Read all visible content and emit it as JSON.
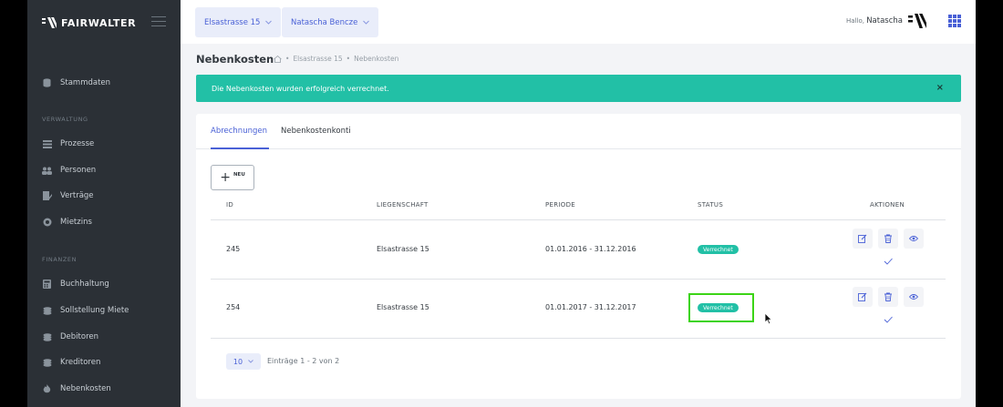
{
  "brand": {
    "name": "FAIRWALTER"
  },
  "sidebar": {
    "stammdaten": "Stammdaten",
    "section_verwaltung": "VERWALTUNG",
    "verwaltung_items": [
      "Prozesse",
      "Personen",
      "Verträge",
      "Mietzins"
    ],
    "section_finanzen": "FINANZEN",
    "finanzen_items": [
      "Buchhaltung",
      "Sollstellung Miete",
      "Debitoren",
      "Kreditoren",
      "Nebenkosten"
    ]
  },
  "topbar": {
    "property_select": "Elsastrasse 15",
    "person_select": "Natascha Bencze",
    "greeting": "Hallo,",
    "user_name": "Natascha"
  },
  "page": {
    "title": "Nebenkosten",
    "breadcrumb": [
      "Elsastrasse 15",
      "Nebenkosten"
    ],
    "breadcrumb_sep": "•"
  },
  "alert": {
    "message": "Die Nebenkosten wurden erfolgreich verrechnet.",
    "close": "×"
  },
  "tabs": [
    "Abrechnungen",
    "Nebenkostenkonti"
  ],
  "new_button": {
    "label": "NEU"
  },
  "table": {
    "headers": [
      "ID",
      "LIEGENSCHAFT",
      "PERIODE",
      "STATUS",
      "AKTIONEN"
    ],
    "rows": [
      {
        "id": "245",
        "property": "Elsastrasse 15",
        "period": "01.01.2016 - 31.12.2016",
        "status": "Verrechnet"
      },
      {
        "id": "254",
        "property": "Elsastrasse 15",
        "period": "01.01.2017 - 31.12.2017",
        "status": "Verrechnet"
      }
    ]
  },
  "pagination": {
    "page_size": "10",
    "info": "Einträge 1 - 2 von 2"
  },
  "colors": {
    "accent": "#4a61d6",
    "success": "#22c0a6",
    "sidebar": "#2b3036",
    "highlight": "#3cd416"
  }
}
